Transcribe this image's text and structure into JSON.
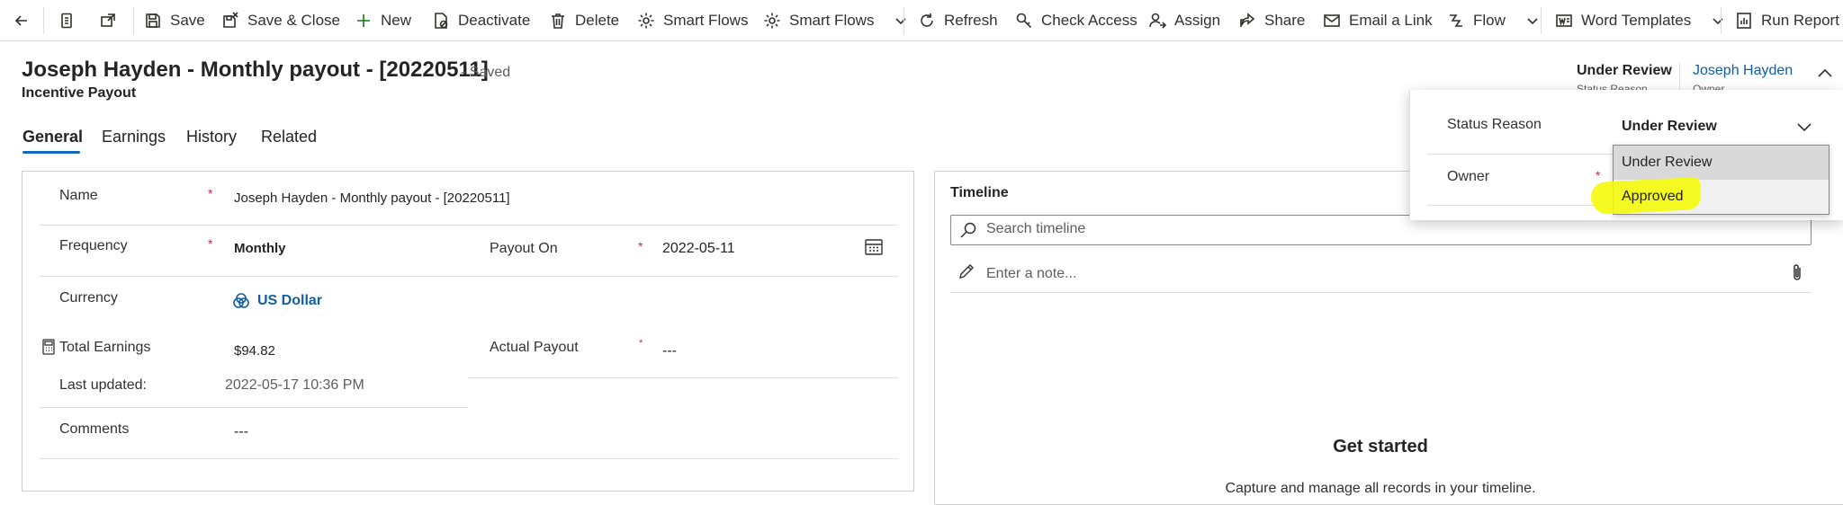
{
  "command_bar": {
    "items": [
      {
        "label": "Save",
        "icon": "save-icon"
      },
      {
        "label": "Save & Close",
        "icon": "save-close-icon"
      },
      {
        "label": "New",
        "icon": "plus-icon"
      },
      {
        "label": "Deactivate",
        "icon": "deactivate-icon"
      },
      {
        "label": "Delete",
        "icon": "trash-icon"
      },
      {
        "label": "Smart Flows",
        "icon": "gear-icon"
      },
      {
        "label": "Smart Flows",
        "icon": "gear-icon"
      },
      {
        "label": "Refresh",
        "icon": "refresh-icon"
      },
      {
        "label": "Check Access",
        "icon": "key-icon"
      },
      {
        "label": "Assign",
        "icon": "person-icon"
      },
      {
        "label": "Share",
        "icon": "share-icon"
      },
      {
        "label": "Email a Link",
        "icon": "mail-icon"
      },
      {
        "label": "Flow",
        "icon": "flow-icon"
      },
      {
        "label": "Word Templates",
        "icon": "word-icon"
      },
      {
        "label": "Run Report",
        "icon": "report-icon"
      }
    ]
  },
  "header": {
    "title": "Joseph Hayden - Monthly payout - [20220511]",
    "save_state": "- Saved",
    "entity": "Incentive Payout",
    "status_value": "Under Review",
    "status_label": "Status Reason",
    "owner_value": "Joseph Hayden",
    "owner_label": "Owner"
  },
  "tabs": [
    "General",
    "Earnings",
    "History",
    "Related"
  ],
  "form": {
    "name_label": "Name",
    "name_value": "Joseph Hayden - Monthly payout - [20220511]",
    "frequency_label": "Frequency",
    "frequency_value": "Monthly",
    "payout_on_label": "Payout On",
    "payout_on_value": "2022-05-11",
    "currency_label": "Currency",
    "currency_value": "US Dollar",
    "total_earnings_label": "Total Earnings",
    "total_earnings_value": "$94.82",
    "last_updated_label": "Last updated:",
    "last_updated_value": "2022-05-17 10:36 PM",
    "actual_payout_label": "Actual Payout",
    "actual_payout_value": "---",
    "comments_label": "Comments",
    "comments_value": "---",
    "required_mark": "*"
  },
  "timeline": {
    "title": "Timeline",
    "search_placeholder": "Search timeline",
    "note_placeholder": "Enter a note...",
    "empty_title": "Get started",
    "empty_subtitle": "Capture and manage all records in your timeline."
  },
  "flyout": {
    "status_label": "Status Reason",
    "status_value": "Under Review",
    "owner_label": "Owner",
    "options": [
      "Under Review",
      "Approved"
    ],
    "highlight_color": "#f4f90a"
  },
  "colors": {
    "accent": "#0f6cbd",
    "link": "#115ea3",
    "required": "#c4314b"
  }
}
